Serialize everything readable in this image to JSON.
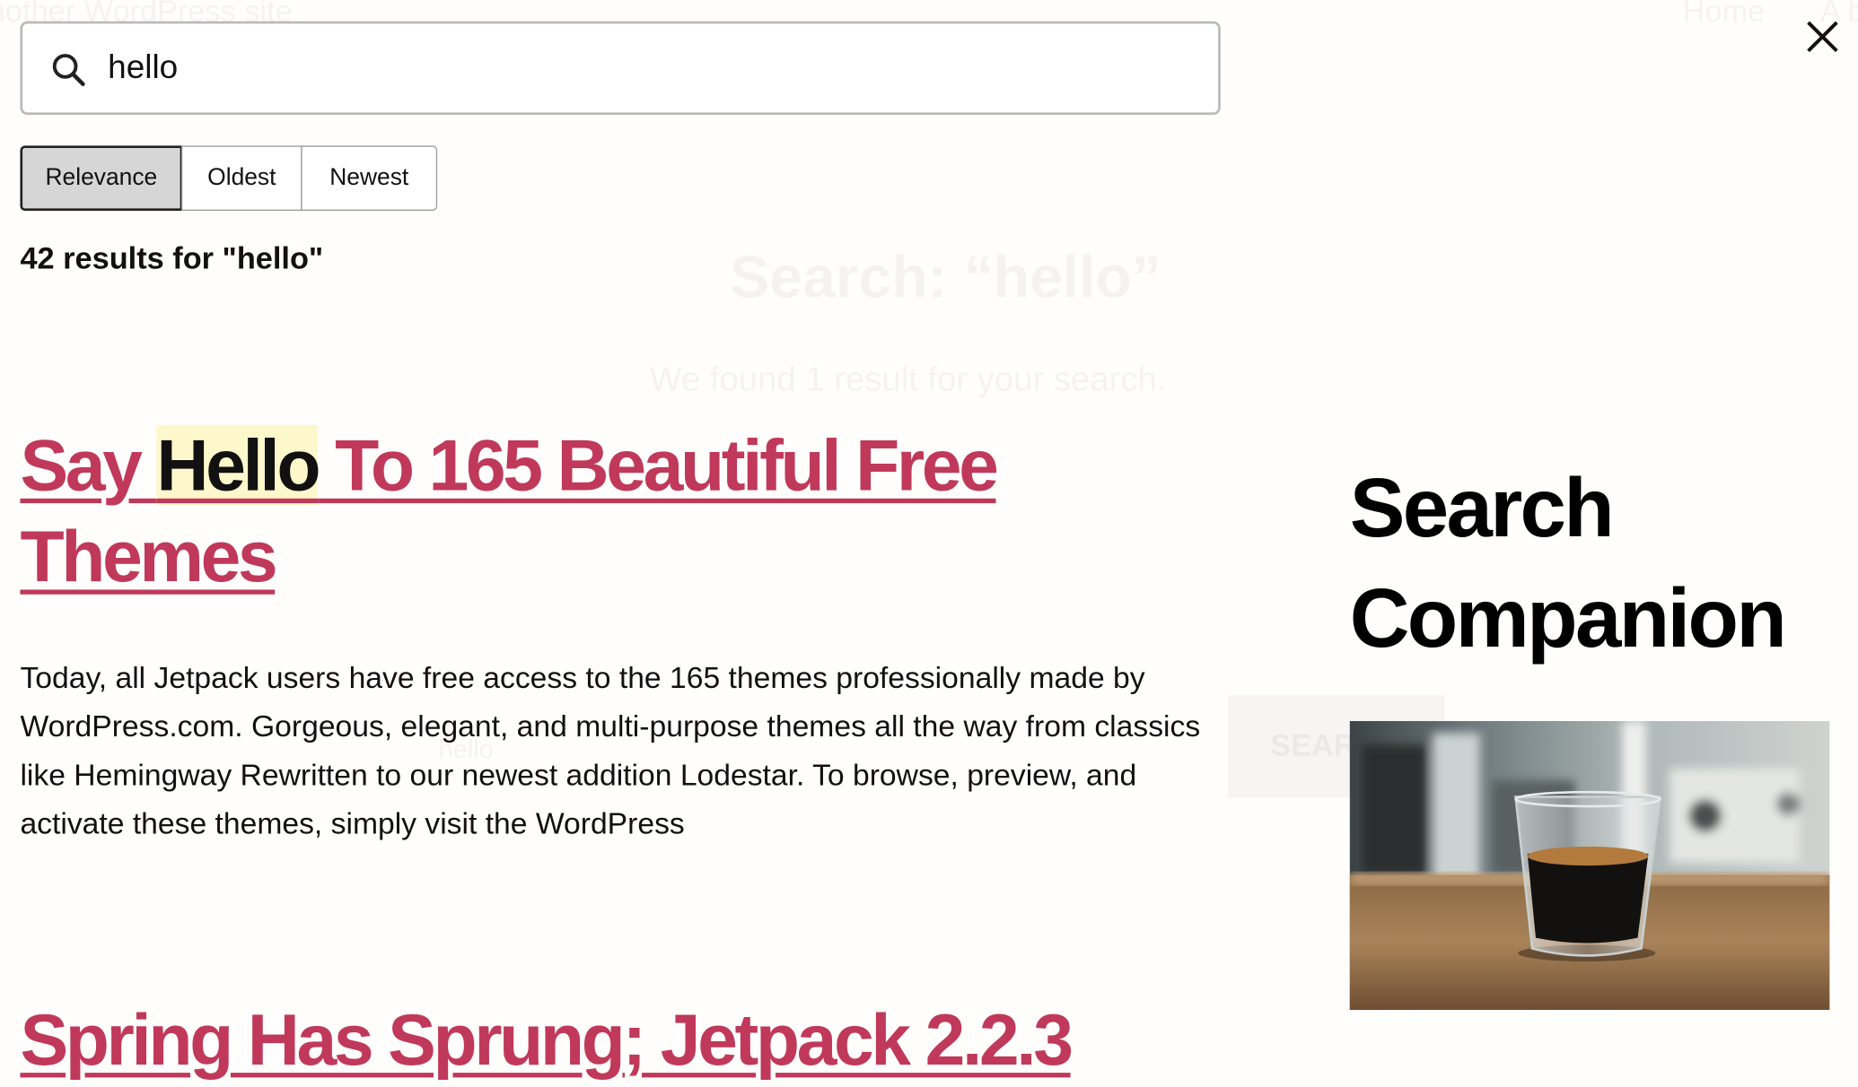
{
  "background": {
    "site_title": "nother WordPress site",
    "nav_home": "Home",
    "nav_more": "A b",
    "heading": "Search: “hello”",
    "subtext": "We found 1 result for your search.",
    "search_value": "hello",
    "search_button": "SEAR"
  },
  "search": {
    "value": "hello",
    "icon": "search-icon"
  },
  "sort": {
    "options": [
      "Relevance",
      "Oldest",
      "Newest"
    ],
    "selected": "Relevance"
  },
  "results_summary": "42 results for \"hello\"",
  "results": [
    {
      "title_before": "Say ",
      "title_highlight": "Hello",
      "title_after": " To 165 Beautiful Free Themes",
      "excerpt": "Today, all Jetpack users have free access to the 165 themes professionally made by WordPress.com. Gorgeous, elegant, and multi-purpose themes all the way from classics like Hemingway Rewritten to our newest addition Lodestar. To browse, preview, and activate these themes, simply visit the WordPress"
    },
    {
      "title": "Spring Has Sprung; Jetpack 2.2.3"
    }
  ],
  "sidebar": {
    "widget_title": "Search Companion"
  },
  "colors": {
    "link": "#c0395a",
    "highlight": "#fdf8cc",
    "active_sort": "#d6d6d6"
  }
}
